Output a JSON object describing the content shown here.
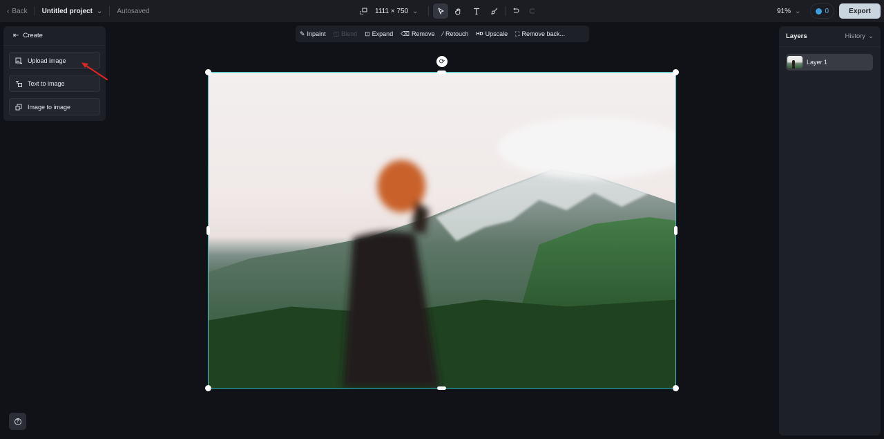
{
  "topbar": {
    "back_label": "Back",
    "project_title": "Untitled project",
    "save_status": "Autosaved",
    "canvas_size": "1111 × 750",
    "zoom_level": "91%",
    "credits": "0",
    "export_label": "Export",
    "tools": [
      {
        "name": "select",
        "icon": "cursor-icon",
        "active": true
      },
      {
        "name": "hand",
        "icon": "hand-icon",
        "active": false
      },
      {
        "name": "text",
        "icon": "text-icon",
        "active": false
      },
      {
        "name": "brush",
        "icon": "brush-icon",
        "active": false
      }
    ],
    "undo_enabled": true,
    "redo_enabled": false
  },
  "create_panel": {
    "title": "Create",
    "items": [
      {
        "label": "Upload image",
        "icon": "upload-image-icon"
      },
      {
        "label": "Text to image",
        "icon": "text-to-image-icon"
      },
      {
        "label": "Image to image",
        "icon": "image-to-image-icon"
      }
    ]
  },
  "edit_toolbar": {
    "items": [
      {
        "label": "Inpaint",
        "icon": "inpaint-icon",
        "enabled": true
      },
      {
        "label": "Blend",
        "icon": "blend-icon",
        "enabled": false
      },
      {
        "label": "Expand",
        "icon": "expand-icon",
        "enabled": true
      },
      {
        "label": "Remove",
        "icon": "eraser-icon",
        "enabled": true
      },
      {
        "label": "Retouch",
        "icon": "magic-wand-icon",
        "enabled": true
      },
      {
        "label": "Upscale",
        "icon": "hd-icon",
        "icon_text": "HD",
        "enabled": true
      },
      {
        "label": "Remove back...",
        "icon": "remove-background-icon",
        "enabled": true
      }
    ]
  },
  "layers_panel": {
    "title": "Layers",
    "history_label": "History",
    "layers": [
      {
        "label": "Layer 1",
        "selected": true
      }
    ]
  },
  "canvas": {
    "image_description": "Blurred person in orange beanie in front of snow-capped green mountain",
    "selection_color": "#2ec4c4"
  },
  "colors": {
    "background": "#111217",
    "panel": "#1d2027",
    "accent": "#2ec4c4",
    "export_button": "#c9d5df"
  }
}
